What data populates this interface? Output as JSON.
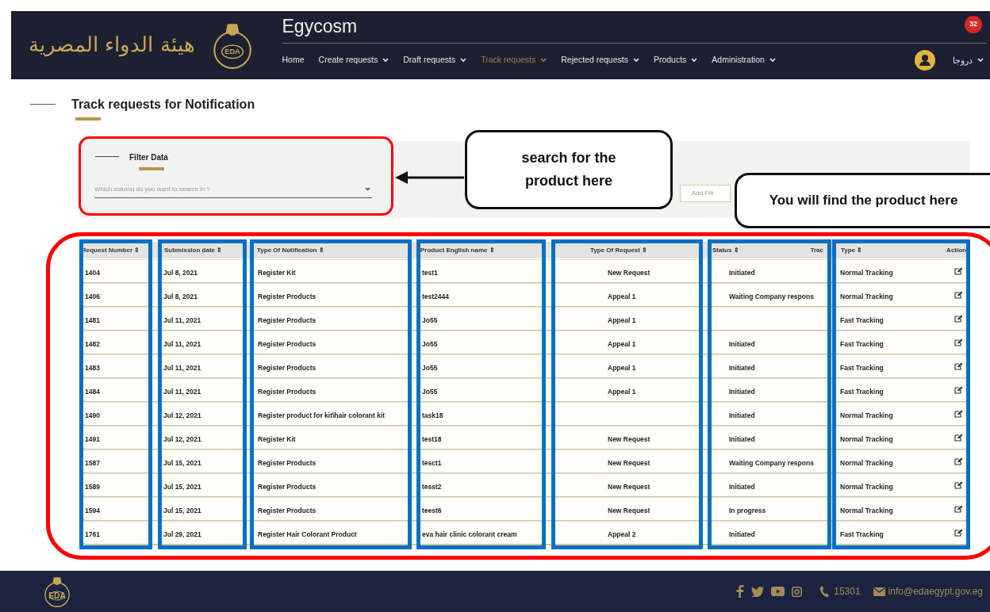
{
  "header": {
    "logo_arabic": "هيئة الدواء المصرية",
    "emblem_text": "EDA",
    "app_title": "Egycosm",
    "notification_count": "32",
    "user_name": "دروجا",
    "nav": [
      {
        "label": "Home",
        "has_menu": false,
        "selected": false
      },
      {
        "label": "Create requests",
        "has_menu": true,
        "selected": false
      },
      {
        "label": "Draft requests",
        "has_menu": true,
        "selected": false
      },
      {
        "label": "Track requests",
        "has_menu": true,
        "selected": true
      },
      {
        "label": "Rejected requests",
        "has_menu": true,
        "selected": false
      },
      {
        "label": "Products",
        "has_menu": true,
        "selected": false
      },
      {
        "label": "Administration",
        "has_menu": true,
        "selected": false
      }
    ]
  },
  "page_title": "Track requests for Notification",
  "filter": {
    "title": "Filter Data",
    "placeholder": "Which column do you want to search in ?",
    "add_button": "Add Filt"
  },
  "annotations": [
    {
      "kind": "callout",
      "text": "search for the product here"
    },
    {
      "kind": "callout",
      "text": "You will find the product here"
    }
  ],
  "table": {
    "columns": [
      {
        "label": "Request Number ⇕"
      },
      {
        "label": "Submission date ⇕"
      },
      {
        "label": "Type Of Notification ⇕"
      },
      {
        "label": "Product English name ⇕"
      },
      {
        "label": "Type Of Request ⇕"
      },
      {
        "label": "Status ⇕",
        "trailing": "Trac"
      },
      {
        "label": "Type ⇕"
      },
      {
        "label": "Action"
      }
    ],
    "rows": [
      {
        "number": "1404",
        "date": "Jul 8, 2021",
        "notification": "Register Kit",
        "product": "test1",
        "request_type": "New Request",
        "status": "Initiated",
        "tracking": "Normal Tracking"
      },
      {
        "number": "1406",
        "date": "Jul 8, 2021",
        "notification": "Register Products",
        "product": "test2444",
        "request_type": "Appeal 1",
        "status": "Waiting Company respons",
        "tracking": "Normal Tracking"
      },
      {
        "number": "1481",
        "date": "Jul 11, 2021",
        "notification": "Register Products",
        "product": "Jo55",
        "request_type": "Appeal 1",
        "tracking": "Fast Tracking"
      },
      {
        "number": "1482",
        "date": "Jul 11, 2021",
        "notification": "Register Products",
        "product": "Jo55",
        "request_type": "Appeal 1",
        "status": "Initiated",
        "tracking": "Fast Tracking"
      },
      {
        "number": "1483",
        "date": "Jul 11, 2021",
        "notification": "Register Products",
        "product": "Jo55",
        "request_type": "Appeal 1",
        "status": "Initiated",
        "tracking": "Fast Tracking"
      },
      {
        "number": "1484",
        "date": "Jul 11, 2021",
        "notification": "Register Products",
        "product": "Jo55",
        "request_type": "Appeal 1",
        "status": "Initiated",
        "tracking": "Fast Tracking"
      },
      {
        "number": "1490",
        "date": "Jul 12, 2021",
        "notification": "Register product for kit\\hair colorant kit",
        "product": "task18",
        "status": "Initiated",
        "tracking": "Normal Tracking"
      },
      {
        "number": "1491",
        "date": "Jul 12, 2021",
        "notification": "Register Kit",
        "product": "test18",
        "request_type": "New Request",
        "status": "Initiated",
        "tracking": "Normal Tracking"
      },
      {
        "number": "1587",
        "date": "Jul 15, 2021",
        "notification": "Register Products",
        "product": "tesct1",
        "request_type": "New Request",
        "status": "Waiting Company respons",
        "tracking": "Normal Tracking"
      },
      {
        "number": "1589",
        "date": "Jul 15, 2021",
        "notification": "Register Products",
        "product": "tesst2",
        "request_type": "New Request",
        "status": "Initiated",
        "tracking": "Normal Tracking"
      },
      {
        "number": "1594",
        "date": "Jul 15, 2021",
        "notification": "Register Products",
        "product": "teest6",
        "request_type": "New Request",
        "status": "In progress",
        "tracking": "Normal Tracking"
      },
      {
        "number": "1761",
        "date": "Jul 29, 2021",
        "notification": "Register Hair Colorant Product",
        "product": "eva hair clinic colorant cream",
        "request_type": "Appeal 2",
        "status": "Initiated",
        "tracking": "Fast Tracking"
      }
    ]
  },
  "footer": {
    "emblem_text": "EDA",
    "phone": "15301",
    "email": "info@edaegypt.gov.eg"
  }
}
